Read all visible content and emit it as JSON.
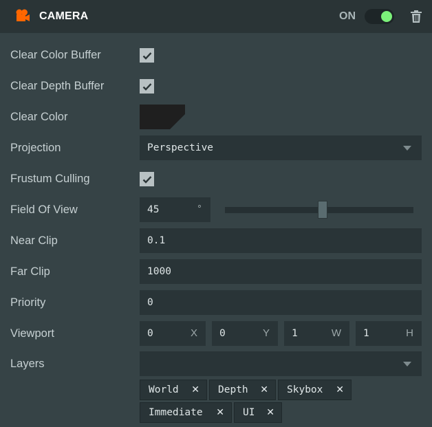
{
  "header": {
    "title": "CAMERA",
    "icon": "camera-icon",
    "toggle_label": "ON",
    "toggle_on": true,
    "accent_color": "#ff6600",
    "toggle_color": "#7bf17a",
    "delete_icon": "trash-icon"
  },
  "fields": {
    "clear_color_buffer": {
      "label": "Clear Color Buffer",
      "checked": true
    },
    "clear_depth_buffer": {
      "label": "Clear Depth Buffer",
      "checked": true
    },
    "clear_color": {
      "label": "Clear Color",
      "value": "#1f1f1f"
    },
    "projection": {
      "label": "Projection",
      "value": "Perspective"
    },
    "frustum_culling": {
      "label": "Frustum Culling",
      "checked": true
    },
    "field_of_view": {
      "label": "Field Of View",
      "value": "45",
      "unit": "°",
      "slider_fraction": 0.52
    },
    "near_clip": {
      "label": "Near Clip",
      "value": "0.1"
    },
    "far_clip": {
      "label": "Far Clip",
      "value": "1000"
    },
    "priority": {
      "label": "Priority",
      "value": "0"
    },
    "viewport": {
      "label": "Viewport",
      "x": {
        "value": "0",
        "tag": "X"
      },
      "y": {
        "value": "0",
        "tag": "Y"
      },
      "w": {
        "value": "1",
        "tag": "W"
      },
      "h": {
        "value": "1",
        "tag": "H"
      }
    },
    "layers": {
      "label": "Layers",
      "value": "",
      "tags": [
        "World",
        "Depth",
        "Skybox",
        "Immediate",
        "UI"
      ],
      "remove_glyph": "✕"
    }
  }
}
